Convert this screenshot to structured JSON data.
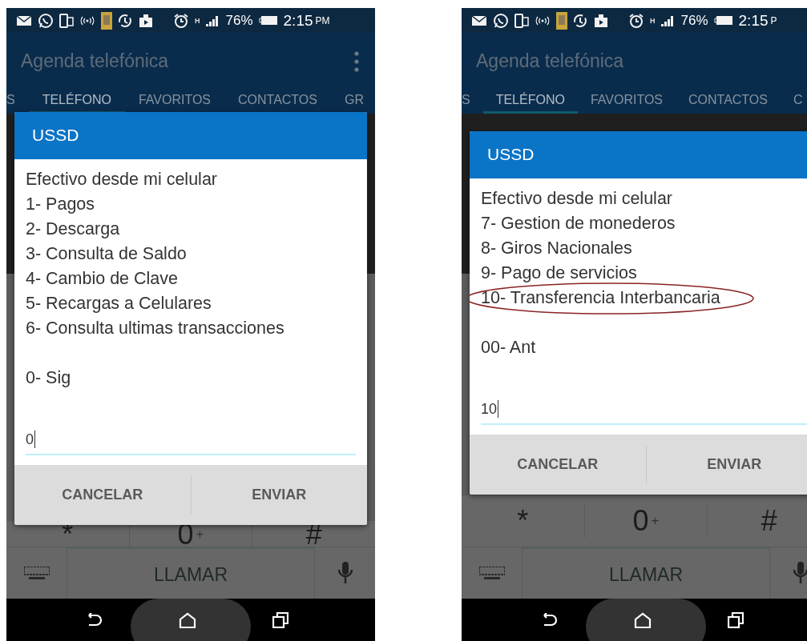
{
  "phones": [
    {
      "status": {
        "network": "H",
        "battery": "76%",
        "time": "2:15",
        "ampm": "PM"
      },
      "app_title": "Agenda telefónica",
      "tabs": [
        {
          "label": "S",
          "selected": false
        },
        {
          "label": "TELÉFONO",
          "selected": true
        },
        {
          "label": "FAVORITOS",
          "selected": false
        },
        {
          "label": "CONTACTOS",
          "selected": false
        },
        {
          "label": "GR",
          "selected": false
        }
      ],
      "dialog": {
        "title": "USSD",
        "header": "Efectivo desde mi celular",
        "options": [
          {
            "text": "1- Pagos",
            "circled": false
          },
          {
            "text": "2- Descarga",
            "circled": false
          },
          {
            "text": "3- Consulta de Saldo",
            "circled": false
          },
          {
            "text": "4- Cambio de Clave",
            "circled": false
          },
          {
            "text": "5- Recargas a Celulares",
            "circled": false
          },
          {
            "text": "6- Consulta ultimas transacciones",
            "circled": false
          }
        ],
        "nav_option": "0- Sig",
        "input_value": "0",
        "buttons": [
          "CANCELAR",
          "ENVIAR"
        ]
      },
      "keys": [
        {
          "main": "*"
        },
        {
          "main": "0",
          "sub": "+"
        },
        {
          "main": "#"
        }
      ],
      "call_label": "LLAMAR"
    },
    {
      "status": {
        "network": "H",
        "battery": "76%",
        "time": "2:15",
        "ampm": "P"
      },
      "app_title": "Agenda telefónica",
      "tabs": [
        {
          "label": "S",
          "selected": false
        },
        {
          "label": "TELÉFONO",
          "selected": true
        },
        {
          "label": "FAVORITOS",
          "selected": false
        },
        {
          "label": "CONTACTOS",
          "selected": false
        },
        {
          "label": "C",
          "selected": false
        }
      ],
      "dialog": {
        "title": "USSD",
        "header": "Efectivo desde mi celular",
        "options": [
          {
            "text": "7- Gestion de monederos",
            "circled": false
          },
          {
            "text": "8- Giros Nacionales",
            "circled": false
          },
          {
            "text": "9- Pago de servicios",
            "circled": false
          },
          {
            "text": "10- Transferencia Interbancaria",
            "circled": true
          }
        ],
        "nav_option": "00- Ant",
        "input_value": "10",
        "buttons": [
          "CANCELAR",
          "ENVIAR"
        ]
      },
      "keys": [
        {
          "main": "*"
        },
        {
          "main": "0",
          "sub": "+"
        },
        {
          "main": "#"
        }
      ],
      "call_label": "LLAMAR"
    }
  ]
}
